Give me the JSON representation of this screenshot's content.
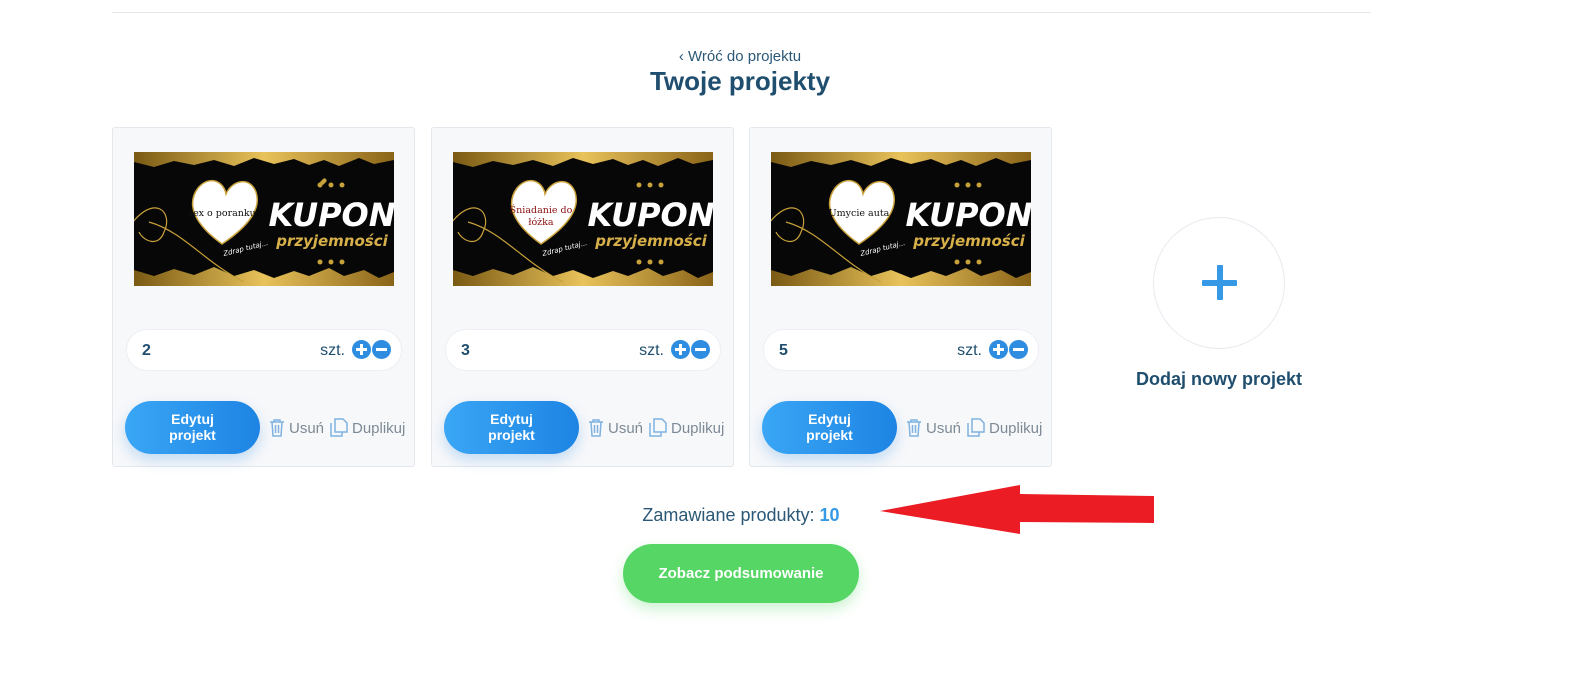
{
  "header": {
    "back_link": "‹ Wróć do projektu",
    "title": "Twoje projekty"
  },
  "projects": [
    {
      "coupon_text": "sex o poranku",
      "quantity": "2",
      "unit": "szt."
    },
    {
      "coupon_text": "Śniadanie do łóżka",
      "quantity": "3",
      "unit": "szt."
    },
    {
      "coupon_text": "Umycie auta",
      "quantity": "5",
      "unit": "szt."
    }
  ],
  "thumbnail": {
    "title": "KUPON",
    "subtitle": "przyjemności",
    "hint": "Zdrap tutaj..."
  },
  "actions": {
    "edit_line1": "Edytuj",
    "edit_line2": "projekt",
    "delete": "Usuń",
    "duplicate": "Duplikuj"
  },
  "add_project": {
    "label": "Dodaj nowy projekt"
  },
  "summary": {
    "label": "Zamawiane produkty:",
    "count": "10"
  },
  "cta": {
    "label": "Zobacz podsumowanie"
  },
  "colors": {
    "primary_blue": "#2e8de0",
    "title_navy": "#1f4e6e",
    "cta_green": "#56d665",
    "arrow_red": "#ec1c24",
    "coupon_gold": "#c9a13a"
  },
  "icons": {
    "plus": "plus-circle-icon",
    "minus": "minus-circle-icon",
    "delete": "trash-icon",
    "duplicate": "copy-icon",
    "add": "plus-icon"
  }
}
